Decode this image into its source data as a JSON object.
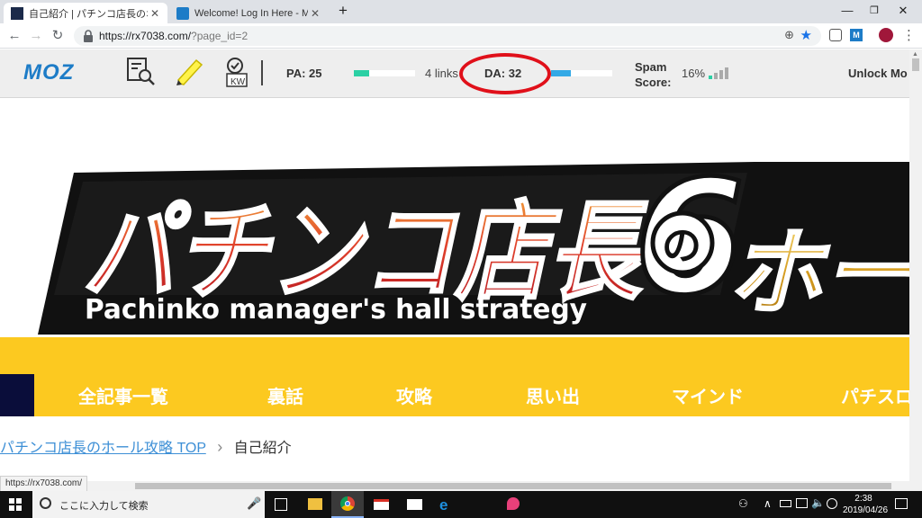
{
  "browser": {
    "tabs": [
      {
        "title": "自己紹介 | パチンコ店長のホール攻略",
        "active": true
      },
      {
        "title": "Welcome! Log In Here - Moz",
        "active": false
      }
    ],
    "new_tab": "+",
    "url_host": "https://rx7038.com/",
    "url_path": "?page_id=2",
    "status_url": "https://rx7038.com/"
  },
  "mozbar": {
    "logo": "MOZ",
    "pa_label": "PA: 25",
    "pa_fraction": 0.25,
    "links": "4 links",
    "da_label": "DA: 32",
    "da_fraction": 0.32,
    "spam_label_1": "Spam",
    "spam_label_2": "Score:",
    "spam_value": "16%",
    "unlock": "Unlock Mo",
    "highlight_color": "#e0101a"
  },
  "banner": {
    "title_jp": "パチンコ店長",
    "of_circle": "の",
    "six": "6",
    "hall": "ホー",
    "subtitle": "Pachinko manager's hall strategy"
  },
  "site_nav": {
    "items": [
      "全記事一覧",
      "裏話",
      "攻略",
      "思い出",
      "マインド",
      "パチスロ"
    ]
  },
  "breadcrumb": {
    "home": "パチンコ店長のホール攻略 TOP",
    "separator": "›",
    "current": "自己紹介"
  },
  "taskbar": {
    "search_placeholder": "ここに入力して検索",
    "time": "2:38",
    "date": "2019/04/26"
  },
  "colors": {
    "brand_yellow": "#fcc920",
    "moz_blue": "#1d7cc7",
    "banner_red": "#d8282a",
    "taskbar": "#101010"
  }
}
